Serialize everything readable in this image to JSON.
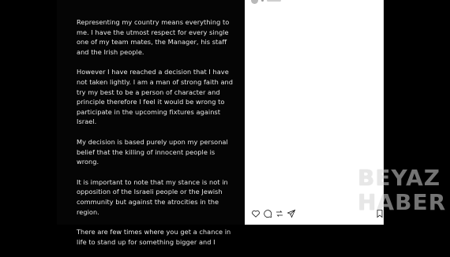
{
  "statement": {
    "paragraphs": [
      "Representing my country means everything to me. I have the utmost respect for every single one of my team mates, the Manager, his staff and the Irish people.",
      "However I have reached a decision that I have not taken lightly. I am a man of strong faith and try my best to be a person of character and principle therefore I feel it would be wrong to participate in the upcoming fixtures against Israel.",
      "My decision is based purely upon my personal belief that the killing of innocent people is wrong.",
      "It is important to note that my stance is not in opposition of the Israeli people or the Jewish community but against the atrocities in the region.",
      "There are few times where you get a chance in life to stand up for something bigger and I"
    ]
  },
  "actions": {
    "icons": [
      "heart-icon",
      "comment-icon",
      "share-icon",
      "send-icon",
      "bookmark-icon"
    ]
  },
  "watermark": {
    "line1": "BEYAZ",
    "line2": "HABER"
  }
}
